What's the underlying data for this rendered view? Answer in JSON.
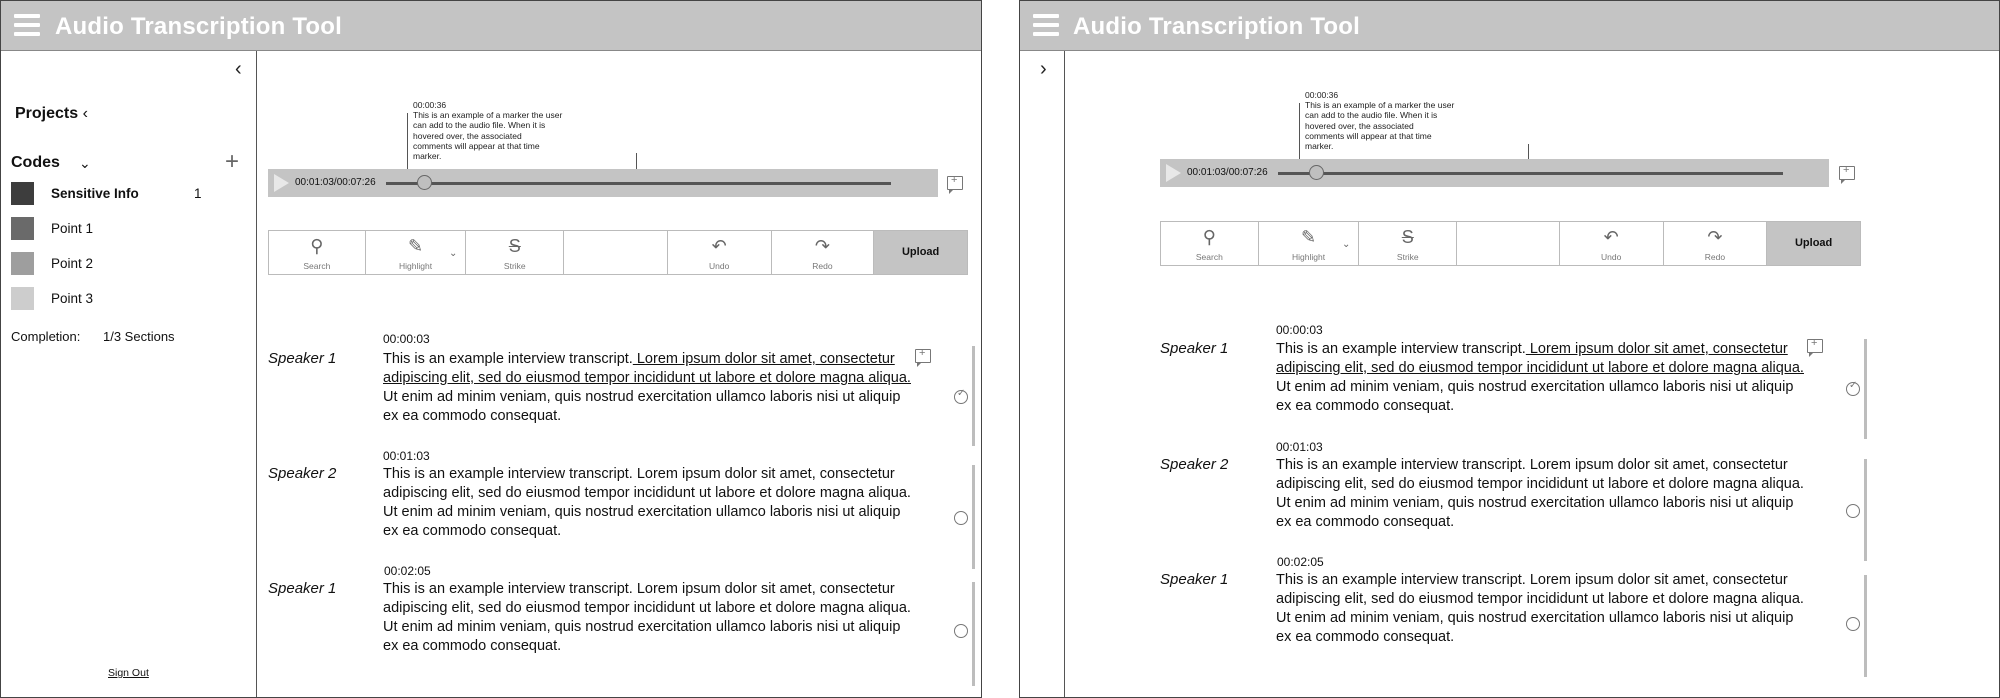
{
  "app": {
    "title": "Audio Transcription Tool"
  },
  "sidebar": {
    "projects_label": "Projects",
    "codes_label": "Codes",
    "codes": [
      {
        "label": "Sensitive Info",
        "count": "1",
        "color": "#3d3d3d",
        "bold": true
      },
      {
        "label": "Point 1",
        "count": "",
        "color": "#6a6a6a",
        "bold": false
      },
      {
        "label": "Point 2",
        "count": "",
        "color": "#9e9e9e",
        "bold": false
      },
      {
        "label": "Point 3",
        "count": "",
        "color": "#cdcdcd",
        "bold": false
      }
    ],
    "completion_label": "Completion:",
    "completion_value": "1/3 Sections",
    "sign_out": "Sign Out"
  },
  "player": {
    "time": "00:01:03/00:07:26",
    "progress": 0.14,
    "marker_time": "00:00:36",
    "marker_note": "This is an example of a marker the user can add to the audio file. When it is hovered over, the associated comments will appear at that time marker."
  },
  "toolbar": {
    "search": "Search",
    "highlight": "Highlight",
    "strike": "Strike",
    "undo": "Undo",
    "redo": "Redo",
    "upload": "Upload"
  },
  "transcript": [
    {
      "speaker": "Speaker 1",
      "time": "00:00:03",
      "text_before": "This is an example interview transcript.",
      "text_underlined": " Lorem ipsum dolor sit amet, consectetur adipiscing elit, sed do eiusmod tempor incididunt ut labore et dolore magna aliqua. ",
      "text_after": "Ut enim ad minim veniam, quis nostrud exercitation ullamco laboris nisi ut aliquip ex ea commodo consequat.",
      "completed": true
    },
    {
      "speaker": "Speaker 2",
      "time": "00:01:03",
      "text_before": "This is an example interview transcript. Lorem ipsum dolor sit amet, consectetur adipiscing elit, sed do eiusmod tempor incididunt ut labore et dolore magna aliqua. Ut enim ad minim veniam, quis nostrud exercitation ullamco laboris nisi ut aliquip ex ea commodo consequat.",
      "text_underlined": "",
      "text_after": "",
      "completed": false
    },
    {
      "speaker": "Speaker 1",
      "time": "00:02:05",
      "text_before": "This is an example interview transcript. Lorem ipsum dolor sit amet, consectetur adipiscing elit, sed do eiusmod tempor incididunt ut labore et dolore magna aliqua. Ut enim ad minim veniam, quis nostrud exercitation ullamco laboris nisi ut aliquip ex ea commodo consequat.",
      "text_underlined": "",
      "text_after": "",
      "completed": false
    }
  ]
}
